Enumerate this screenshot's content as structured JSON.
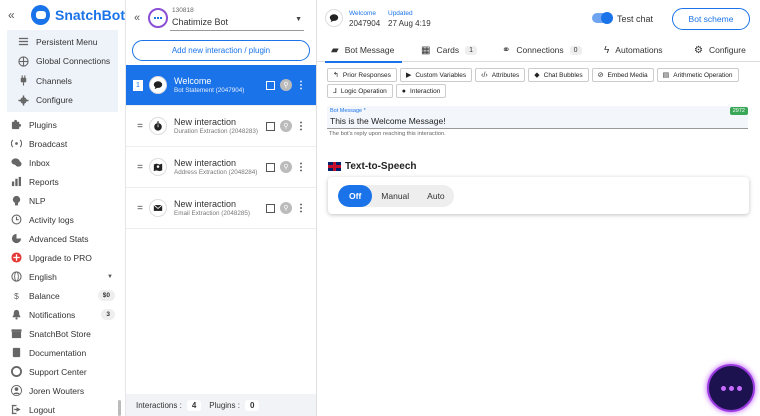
{
  "brand": {
    "name": "SnatchBot",
    "accent": "#1a73e8"
  },
  "nav": {
    "group": [
      {
        "label": "Persistent Menu",
        "icon": "menu-icon"
      },
      {
        "label": "Global Connections",
        "icon": "globe-icon"
      },
      {
        "label": "Channels",
        "icon": "plug-icon"
      },
      {
        "label": "Configure",
        "icon": "gear-icon"
      }
    ],
    "items": [
      {
        "label": "Plugins",
        "icon": "puzzle-icon"
      },
      {
        "label": "Broadcast",
        "icon": "broadcast-icon"
      },
      {
        "label": "Inbox",
        "icon": "chat-icon"
      },
      {
        "label": "Reports",
        "icon": "chart-icon"
      },
      {
        "label": "NLP",
        "icon": "bulb-icon"
      },
      {
        "label": "Activity logs",
        "icon": "history-icon"
      },
      {
        "label": "Advanced Stats",
        "icon": "stats-icon"
      },
      {
        "label": "Upgrade to PRO",
        "icon": "upgrade-icon"
      },
      {
        "label": "English",
        "icon": "globe-icon"
      },
      {
        "label": "Balance",
        "icon": "dollar-icon",
        "badge": "$0"
      },
      {
        "label": "Notifications",
        "icon": "bell-icon",
        "badge": "3"
      },
      {
        "label": "SnatchBot Store",
        "icon": "store-icon"
      },
      {
        "label": "Documentation",
        "icon": "book-icon"
      },
      {
        "label": "Support Center",
        "icon": "support-icon"
      },
      {
        "label": "Joren Wouters",
        "icon": "user-icon"
      },
      {
        "label": "Logout",
        "icon": "logout-icon"
      }
    ]
  },
  "bot": {
    "id": "130818",
    "name": "Chatimize Bot"
  },
  "add_button": "Add new interaction / plugin",
  "interactions": [
    {
      "title": "Welcome",
      "subtitle": "Bot Statement (2047904)",
      "active": true,
      "handle": "1",
      "icon": "chat-bubble-icon"
    },
    {
      "title": "New interaction",
      "subtitle": "Duration Extraction (2048283)",
      "active": false,
      "handle": "=",
      "icon": "stopwatch-icon"
    },
    {
      "title": "New interaction",
      "subtitle": "Address Extraction (2048284)",
      "active": false,
      "handle": "=",
      "icon": "map-icon"
    },
    {
      "title": "New interaction",
      "subtitle": "Email Extraction (2048285)",
      "active": false,
      "handle": "=",
      "icon": "envelope-icon"
    }
  ],
  "footer": {
    "interactions_label": "Interactions :",
    "interactions_count": "4",
    "plugins_label": "Plugins :",
    "plugins_count": "0"
  },
  "header": {
    "name_label": "Welcome",
    "name_value": "2047904",
    "updated_label": "Updated",
    "updated_value": "27 Aug 4:19",
    "test_chat": "Test chat",
    "scheme_button": "Bot scheme"
  },
  "tabs": [
    {
      "label": "Bot Message",
      "icon": "message-icon",
      "active": true
    },
    {
      "label": "Cards",
      "icon": "grid-icon",
      "count": "1"
    },
    {
      "label": "Connections",
      "icon": "link-icon",
      "count": "0"
    },
    {
      "label": "Automations",
      "icon": "bolt-icon"
    },
    {
      "label": "Configure",
      "icon": "gear-icon"
    }
  ],
  "chips": [
    {
      "label": "Prior Responses",
      "icon": "reply-icon"
    },
    {
      "label": "Custom Variables",
      "icon": "play-icon"
    },
    {
      "label": "Attributes",
      "icon": "code-icon"
    },
    {
      "label": "Chat Bubbles",
      "icon": "bubbles-icon"
    },
    {
      "label": "Embed Media",
      "icon": "media-icon"
    },
    {
      "label": "Arithmetic Operation",
      "icon": "calculator-icon"
    },
    {
      "label": "Logic Operation",
      "icon": "logic-icon"
    },
    {
      "label": "Interaction",
      "icon": "chat-icon"
    }
  ],
  "message": {
    "label": "Bot Message *",
    "value": "This is the Welcome Message!",
    "count": "2972",
    "hint": "The bot's reply upon reaching this interaction."
  },
  "tts": {
    "title": "Text-to-Speech",
    "options": [
      "Off",
      "Manual",
      "Auto"
    ],
    "selected": "Off"
  }
}
